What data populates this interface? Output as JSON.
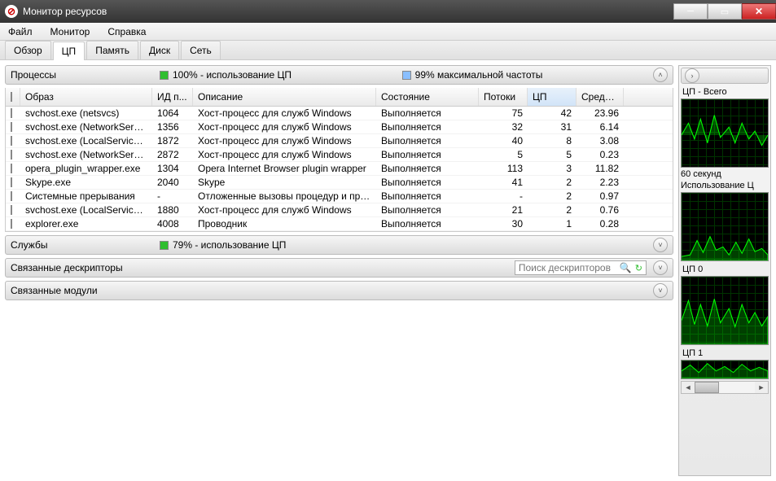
{
  "window": {
    "title": "Монитор ресурсов"
  },
  "menu": {
    "file": "Файл",
    "monitor": "Монитор",
    "help": "Справка"
  },
  "tabs": {
    "overview": "Обзор",
    "cpu": "ЦП",
    "memory": "Память",
    "disk": "Диск",
    "network": "Сеть"
  },
  "processes": {
    "title": "Процессы",
    "cpu_usage": "100% - использование ЦП",
    "max_freq": "99% максимальной частоты",
    "headers": {
      "image": "Образ",
      "pid": "ИД п...",
      "desc": "Описание",
      "state": "Состояние",
      "threads": "Потоки",
      "cpu": "ЦП",
      "avg": "Средн..."
    },
    "rows": [
      {
        "image": "svchost.exe (netsvcs)",
        "pid": "1064",
        "desc": "Хост-процесс для служб Windows",
        "state": "Выполняется",
        "threads": "75",
        "cpu": "42",
        "avg": "23.96"
      },
      {
        "image": "svchost.exe (NetworkService)",
        "pid": "1356",
        "desc": "Хост-процесс для служб Windows",
        "state": "Выполняется",
        "threads": "32",
        "cpu": "31",
        "avg": "6.14"
      },
      {
        "image": "svchost.exe (LocalServiceAn...",
        "pid": "1872",
        "desc": "Хост-процесс для служб Windows",
        "state": "Выполняется",
        "threads": "40",
        "cpu": "8",
        "avg": "3.08"
      },
      {
        "image": "svchost.exe (NetworkService...",
        "pid": "2872",
        "desc": "Хост-процесс для служб Windows",
        "state": "Выполняется",
        "threads": "5",
        "cpu": "5",
        "avg": "0.23"
      },
      {
        "image": "opera_plugin_wrapper.exe",
        "pid": "1304",
        "desc": "Opera Internet Browser plugin wrapper",
        "state": "Выполняется",
        "threads": "113",
        "cpu": "3",
        "avg": "11.82"
      },
      {
        "image": "Skype.exe",
        "pid": "2040",
        "desc": "Skype",
        "state": "Выполняется",
        "threads": "41",
        "cpu": "2",
        "avg": "2.23"
      },
      {
        "image": "Системные прерывания",
        "pid": "-",
        "desc": "Отложенные вызовы процедур и про...",
        "state": "Выполняется",
        "threads": "-",
        "cpu": "2",
        "avg": "0.97"
      },
      {
        "image": "svchost.exe (LocalServiceNo...",
        "pid": "1880",
        "desc": "Хост-процесс для служб Windows",
        "state": "Выполняется",
        "threads": "21",
        "cpu": "2",
        "avg": "0.76"
      },
      {
        "image": "explorer.exe",
        "pid": "4008",
        "desc": "Проводник",
        "state": "Выполняется",
        "threads": "30",
        "cpu": "1",
        "avg": "0.28"
      }
    ]
  },
  "services": {
    "title": "Службы",
    "cpu_usage": "79% - использование ЦП"
  },
  "handles": {
    "title": "Связанные дескрипторы",
    "search_placeholder": "Поиск дескрипторов"
  },
  "modules": {
    "title": "Связанные модули"
  },
  "charts": {
    "total": "ЦП - Всего",
    "seconds": "60 секунд",
    "usage": "Использование Ц",
    "cpu0": "ЦП 0",
    "cpu1": "ЦП 1"
  }
}
